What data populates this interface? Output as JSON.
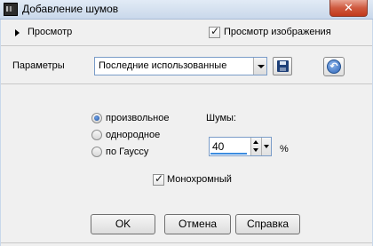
{
  "window": {
    "title": "Добавление шумов",
    "close_symbol": "✕"
  },
  "preview": {
    "label": "Просмотр",
    "image_preview_label": "Просмотр изображения",
    "image_preview_checked": true
  },
  "parameters": {
    "label": "Параметры",
    "preset_value": "Последние использованные"
  },
  "noise_type": {
    "options": [
      {
        "label": "произвольное",
        "selected": true
      },
      {
        "label": "однородное",
        "selected": false
      },
      {
        "label": "по Гауссу",
        "selected": false
      }
    ]
  },
  "noise": {
    "label": "Шумы:",
    "value": "40",
    "unit": "%"
  },
  "monochrome": {
    "label": "Монохромный",
    "checked": true
  },
  "buttons": {
    "ok": "OK",
    "cancel": "Отмена",
    "help": "Справка"
  },
  "icons": {
    "save": "save-disk-icon",
    "reset": "reset-icon",
    "check_mark": "✓",
    "reset_glyph": "↶"
  }
}
